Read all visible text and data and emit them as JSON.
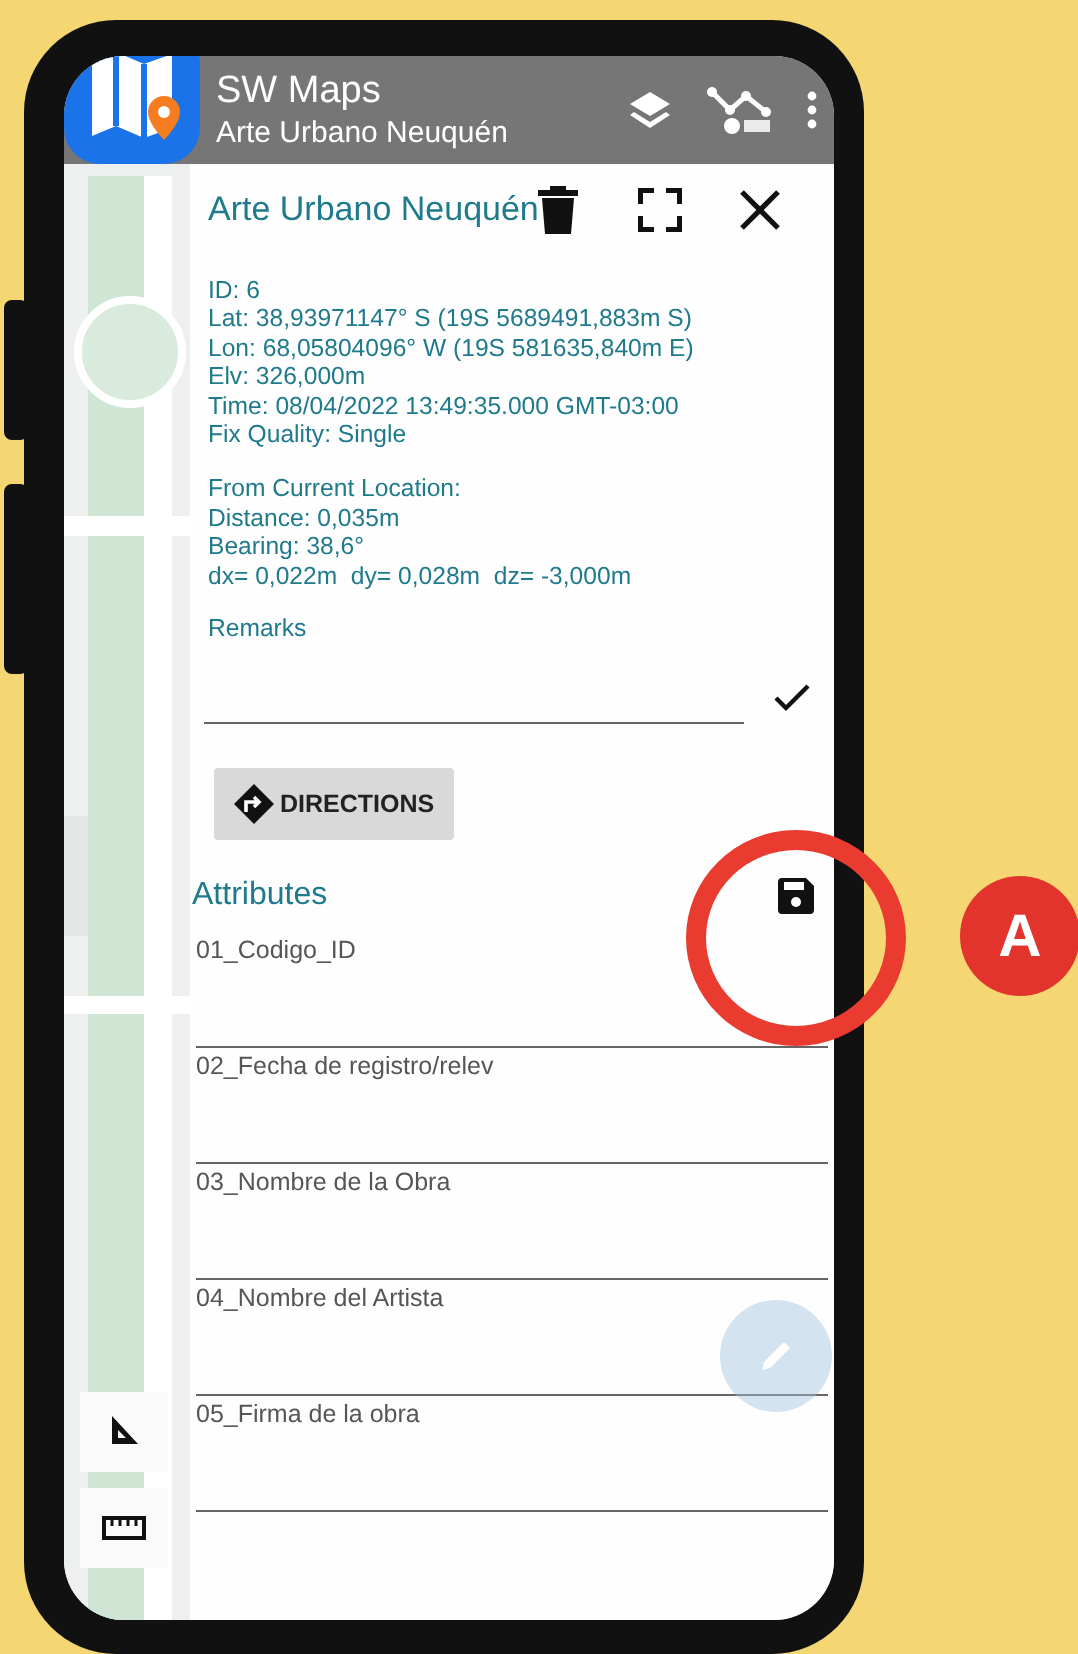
{
  "app_bar": {
    "title": "SW Maps",
    "subtitle": "Arte Urbano Neuquén"
  },
  "panel": {
    "title": "Arte Urbano Neuquén",
    "info": [
      "ID: 6",
      "Lat: 38,93971147° S (19S 5689491,883m S)",
      "Lon: 68,05804096° W (19S 581635,840m E)",
      "Elv: 326,000m",
      "Time: 08/04/2022 13:49:35.000 GMT-03:00",
      "Fix Quality: Single"
    ],
    "location": [
      "From Current Location:",
      "Distance: 0,035m",
      "Bearing: 38,6°",
      "dx= 0,022m  dy= 0,028m  dz= -3,000m"
    ],
    "remarks_label": "Remarks",
    "directions": "DIRECTIONS",
    "attributes_title": "Attributes",
    "attributes": [
      {
        "label": "01_Codigo_ID"
      },
      {
        "label": "02_Fecha de registro/relev"
      },
      {
        "label": "03_Nombre de la Obra"
      },
      {
        "label": "04_Nombre del Artista"
      },
      {
        "label": "05_Firma de la obra"
      }
    ]
  },
  "annotation": {
    "label": "A"
  }
}
